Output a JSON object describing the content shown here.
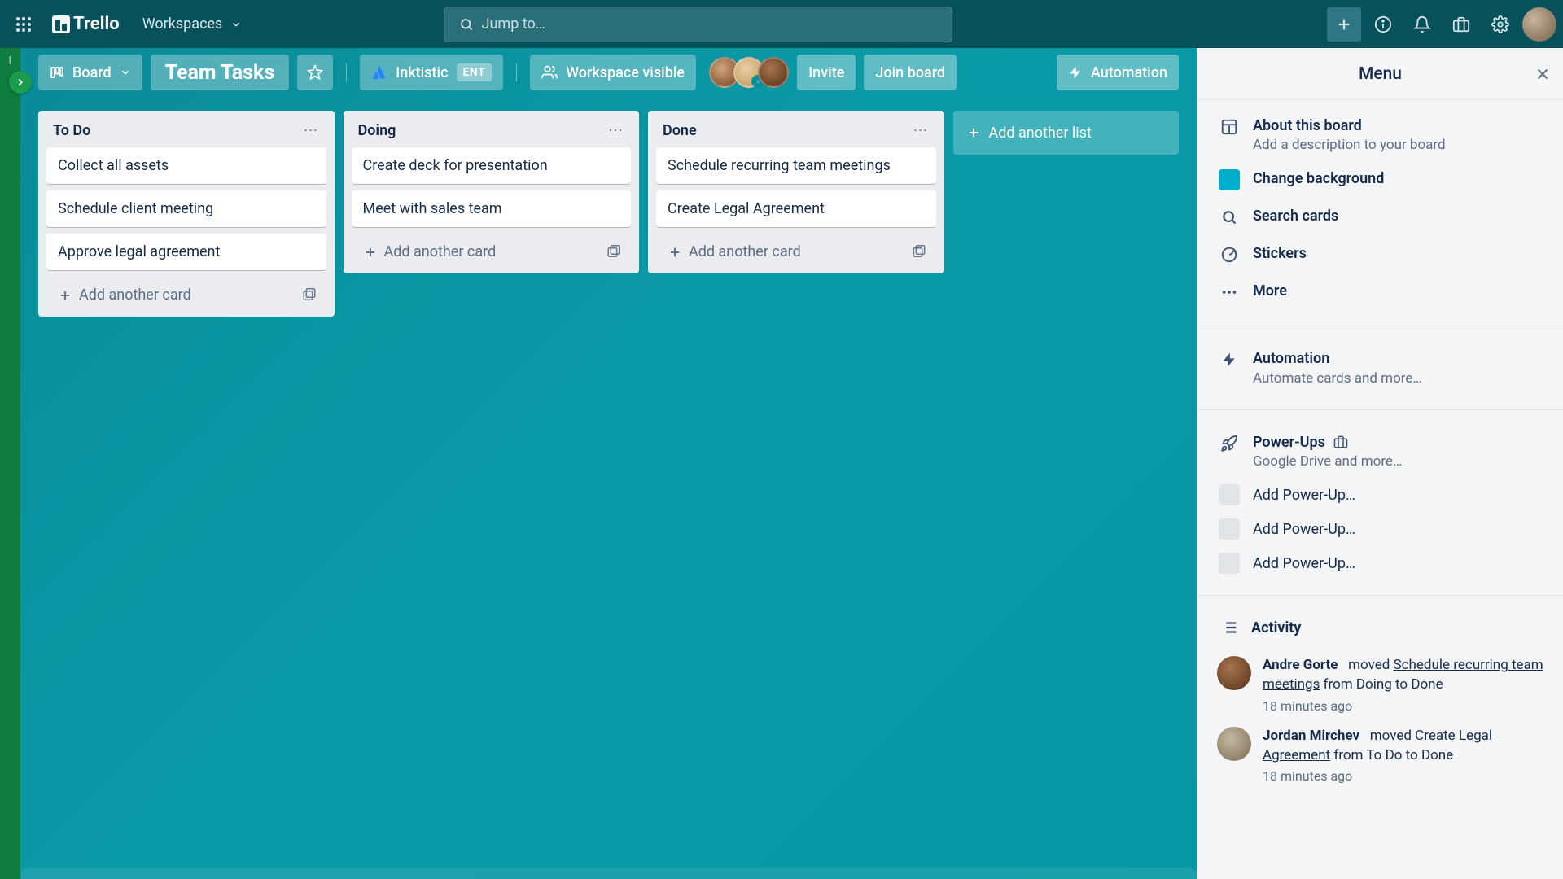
{
  "topbar": {
    "logo_text": "Trello",
    "workspaces_label": "Workspaces",
    "search_placeholder": "Jump to…"
  },
  "board": {
    "view_switch_label": "Board",
    "name": "Team Tasks",
    "org_name": "Inktistic",
    "org_badge": "ENT",
    "workspace_visible_label": "Workspace visible",
    "invite_label": "Invite",
    "join_label": "Join board",
    "automation_label": "Automation",
    "add_list_label": "Add another list"
  },
  "lists": [
    {
      "title": "To Do",
      "cards": [
        "Collect all assets",
        "Schedule client meeting",
        "Approve legal agreement"
      ],
      "add_label": "Add another card"
    },
    {
      "title": "Doing",
      "cards": [
        "Create deck for presentation",
        "Meet with sales team"
      ],
      "add_label": "Add another card"
    },
    {
      "title": "Done",
      "cards": [
        "Schedule recurring team meetings",
        "Create Legal Agreement"
      ],
      "add_label": "Add another card"
    }
  ],
  "menu": {
    "title": "Menu",
    "about_title": "About this board",
    "about_sub": "Add a description to your board",
    "bg_color": "#00AECC",
    "bg_label": "Change background",
    "search_label": "Search cards",
    "stickers_label": "Stickers",
    "more_label": "More",
    "automation_title": "Automation",
    "automation_sub": "Automate cards and more…",
    "powerups_title": "Power-Ups",
    "powerups_sub": "Google Drive and more…",
    "powerup_items": [
      "Add Power-Up…",
      "Add Power-Up…",
      "Add Power-Up…"
    ],
    "activity_label": "Activity",
    "activity": [
      {
        "name": "Andre Gorte",
        "action": "moved",
        "link": "Schedule recurring team meetings",
        "rest": "from Doing to Done",
        "time": "18 minutes ago"
      },
      {
        "name": "Jordan Mirchev",
        "action": "moved",
        "link": "Create Legal Agreement",
        "rest": "from To Do to Done",
        "time": "18 minutes ago"
      }
    ]
  }
}
